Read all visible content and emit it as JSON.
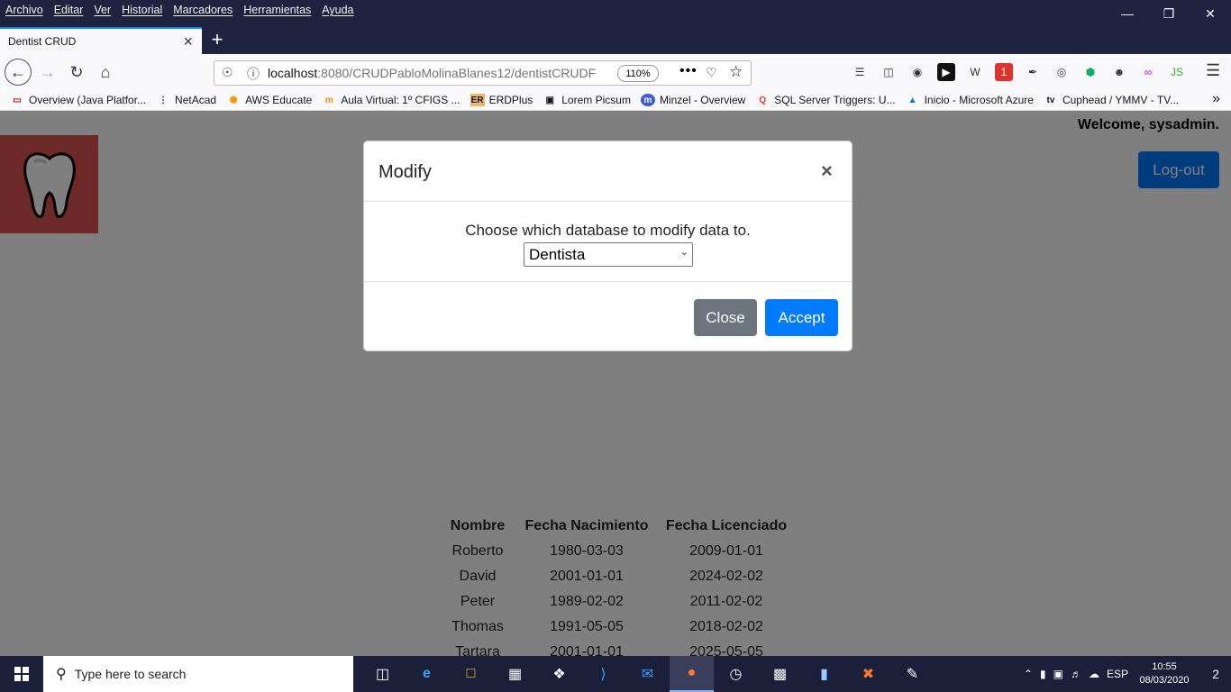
{
  "menubar": {
    "items": [
      "Archivo",
      "Editar",
      "Ver",
      "Historial",
      "Marcadores",
      "Herramientas",
      "Ayuda"
    ]
  },
  "tab": {
    "title": "Dentist CRUD"
  },
  "urlbar": {
    "host": "localhost",
    "path": ":8080/CRUDPabloMolinaBlanes12/dentistCRUDF",
    "zoom": "110%"
  },
  "bookmarks": [
    {
      "label": "Overview (Java Platfor...",
      "icon": "oracle-icon"
    },
    {
      "label": "NetAcad",
      "icon": "cisco-icon"
    },
    {
      "label": "AWS Educate",
      "icon": "aws-icon"
    },
    {
      "label": "Aula Virtual: 1º CFIGS ...",
      "icon": "moodle-icon"
    },
    {
      "label": "ERDPlus",
      "icon": "er-icon"
    },
    {
      "label": "Lorem Picsum",
      "icon": "picture-icon"
    },
    {
      "label": "Minzel - Overview",
      "icon": "m-icon"
    },
    {
      "label": "SQL Server Triggers: U...",
      "icon": "q-icon"
    },
    {
      "label": "Inicio - Microsoft Azure",
      "icon": "azure-icon"
    },
    {
      "label": "Cuphead / YMMV - TV...",
      "icon": "tv-icon"
    }
  ],
  "page": {
    "welcome": "Welcome, sysadmin.",
    "logout_label": "Log-out",
    "table": {
      "headers": [
        "Nombre",
        "Fecha Nacimiento",
        "Fecha Licenciado"
      ],
      "rows": [
        [
          "Roberto",
          "1980-03-03",
          "2009-01-01"
        ],
        [
          "David",
          "2001-01-01",
          "2024-02-02"
        ],
        [
          "Peter",
          "1989-02-02",
          "2011-02-02"
        ],
        [
          "Thomas",
          "1991-05-05",
          "2018-02-02"
        ],
        [
          "Tartara",
          "2001-01-01",
          "2025-05-05"
        ]
      ]
    }
  },
  "modal": {
    "title": "Modify",
    "close_symbol": "×",
    "prompt": "Choose which database to modify data to.",
    "select_value": "Dentista",
    "close_label": "Close",
    "accept_label": "Accept"
  },
  "taskbar": {
    "search_placeholder": "Type here to search",
    "language": "ESP",
    "time": "10:55",
    "date": "08/03/2020",
    "notifications": "2"
  },
  "colors": {
    "primary": "#007bff",
    "secondary": "#6c757d",
    "logo_bg": "#d9534f",
    "chrome": "#202340"
  }
}
